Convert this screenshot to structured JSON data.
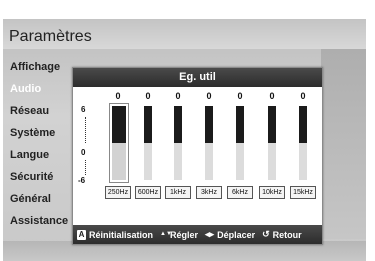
{
  "screen": {
    "title": "Paramètres"
  },
  "menu": {
    "items": [
      {
        "label": "Affichage"
      },
      {
        "label": "Audio"
      },
      {
        "label": "Réseau"
      },
      {
        "label": "Système"
      },
      {
        "label": "Langue"
      },
      {
        "label": "Sécurité"
      },
      {
        "label": "Général"
      },
      {
        "label": "Assistance"
      }
    ],
    "active_index": 1
  },
  "equalizer": {
    "title": "Eg. util",
    "scale": {
      "max": "6",
      "zero": "0",
      "min": "-6"
    },
    "bands": [
      {
        "freq": "250Hz",
        "value": "0",
        "level": 0
      },
      {
        "freq": "600Hz",
        "value": "0",
        "level": 0
      },
      {
        "freq": "1kHz",
        "value": "0",
        "level": 0
      },
      {
        "freq": "3kHz",
        "value": "0",
        "level": 0
      },
      {
        "freq": "6kHz",
        "value": "0",
        "level": 0
      },
      {
        "freq": "10kHz",
        "value": "0",
        "level": 0
      },
      {
        "freq": "15kHz",
        "value": "0",
        "level": 0
      }
    ],
    "selected_band": 0
  },
  "footer": {
    "key_a": "A",
    "reset": "Réinitialisation",
    "adjust_glyph": "▲▼",
    "adjust": "Régler",
    "move_glyph": "◂▸",
    "move": "Déplacer",
    "back_glyph": "↺",
    "back": "Retour"
  }
}
